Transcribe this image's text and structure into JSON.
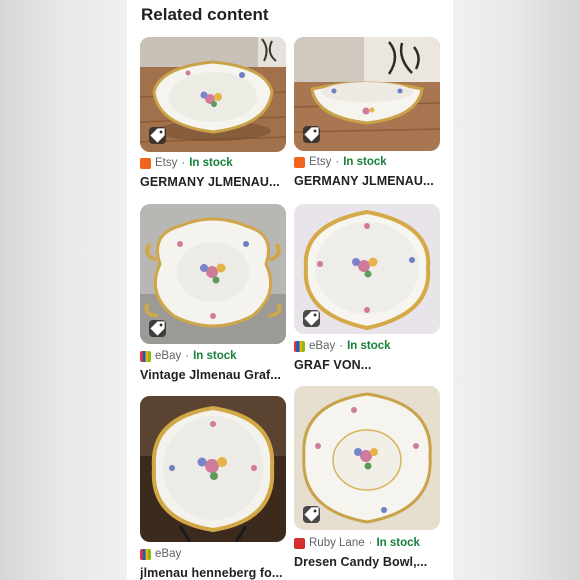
{
  "section": {
    "heading": "Related content"
  },
  "cards": [
    {
      "source": "Etsy",
      "separator": "·",
      "stock": "In stock",
      "title": "GERMANY JLMENAU..."
    },
    {
      "source": "Etsy",
      "separator": "·",
      "stock": "In stock",
      "title": "GERMANY JLMENAU..."
    },
    {
      "source": "eBay",
      "separator": "·",
      "stock": "In stock",
      "title": "Vintage Jlmenau Graf..."
    },
    {
      "source": "eBay",
      "separator": "·",
      "stock": "In stock",
      "title": "GRAF VON..."
    },
    {
      "source": "eBay",
      "title": "jlmenau henneberg fo..."
    },
    {
      "source": "Ruby Lane",
      "separator": "·",
      "stock": "In stock",
      "title": "Dresen Candy Bowl,..."
    }
  ],
  "colors": {
    "stock_green": "#188038",
    "etsy_orange": "#f1641e",
    "ebay_purple": "#6c3aa8",
    "rubylane_red": "#d32f2f"
  },
  "icons": {
    "tag": "price-tag-icon"
  }
}
